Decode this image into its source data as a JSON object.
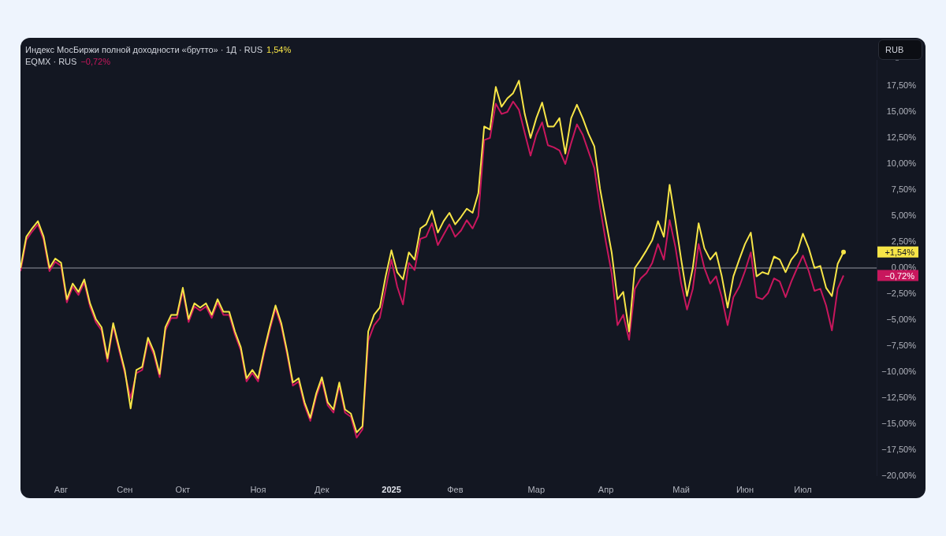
{
  "currency_button": "RUB",
  "legend": [
    {
      "value": "1,54%"
    },
    {
      "value": "−0,72%"
    }
  ],
  "price_tags": [
    {
      "label": "+1,54%"
    },
    {
      "label": "−0,72%"
    }
  ],
  "chart_data": {
    "type": "line",
    "ylim": [
      -20,
      20
    ],
    "categories": [
      null,
      null,
      null,
      null,
      null,
      null,
      null,
      "Авг",
      null,
      null,
      null,
      null,
      null,
      null,
      null,
      null,
      null,
      null,
      "Сен",
      null,
      null,
      null,
      null,
      null,
      null,
      null,
      null,
      null,
      "Окт",
      null,
      null,
      null,
      null,
      null,
      null,
      null,
      null,
      null,
      null,
      null,
      null,
      "Ноя",
      null,
      null,
      null,
      null,
      null,
      null,
      null,
      null,
      null,
      null,
      "Дек",
      null,
      null,
      null,
      null,
      null,
      null,
      null,
      null,
      null,
      null,
      null,
      "**2025**",
      null,
      null,
      null,
      null,
      null,
      null,
      null,
      null,
      null,
      null,
      "Фев",
      null,
      null,
      null,
      null,
      null,
      null,
      null,
      null,
      null,
      null,
      null,
      null,
      null,
      "Мар",
      null,
      null,
      null,
      null,
      null,
      null,
      null,
      null,
      null,
      null,
      null,
      "Апр",
      null,
      null,
      null,
      null,
      null,
      null,
      null,
      null,
      null,
      null,
      null,
      null,
      "Май",
      null,
      null,
      null,
      null,
      null,
      null,
      null,
      null,
      null,
      null,
      "Июн",
      null,
      null,
      null,
      null,
      null,
      null,
      null,
      null,
      null,
      "Июл",
      null,
      null,
      null,
      null,
      null,
      null,
      null
    ],
    "series": [
      {
        "name": "Индекс МосБиржи полной доходности «брутто» · 1Д · RUS",
        "color": "#f7e547",
        "values": [
          0,
          3.0,
          3.8,
          4.5,
          3.0,
          0,
          0.9,
          0.5,
          -3.0,
          -1.5,
          -2.3,
          -1.1,
          -3.4,
          -4.9,
          -5.7,
          -8.7,
          -5.3,
          -7.6,
          -9.8,
          -13.5,
          -9.8,
          -9.5,
          -6.7,
          -8.0,
          -10.2,
          -5.7,
          -4.5,
          -4.5,
          -1.9,
          -4.9,
          -3.4,
          -3.8,
          -3.4,
          -4.5,
          -3.0,
          -4.2,
          -4.2,
          -6.1,
          -7.6,
          -10.6,
          -9.8,
          -10.6,
          -8.0,
          -5.7,
          -3.6,
          -5.3,
          -8.0,
          -11.0,
          -10.6,
          -12.9,
          -14.4,
          -12.1,
          -10.5,
          -12.9,
          -13.6,
          -11.0,
          -13.6,
          -14.0,
          -15.8,
          -15.2,
          -6.1,
          -4.5,
          -3.8,
          -0.8,
          1.7,
          -0.4,
          -1.1,
          1.5,
          0.8,
          3.8,
          4.2,
          5.5,
          3.4,
          4.5,
          5.3,
          4.2,
          4.9,
          5.7,
          5.3,
          7.2,
          13.6,
          13.3,
          17.4,
          15.5,
          16.3,
          16.8,
          18.0,
          14.8,
          12.5,
          14.4,
          15.9,
          13.6,
          13.6,
          14.4,
          11.0,
          14.4,
          15.7,
          14.4,
          12.9,
          11.7,
          7.6,
          4.5,
          1.5,
          -3.0,
          -2.3,
          -6.1,
          0,
          0.8,
          1.7,
          2.7,
          4.5,
          3.0,
          8.0,
          4.5,
          0.8,
          -2.7,
          0,
          4.3,
          1.9,
          0.8,
          1.5,
          -0.8,
          -3.8,
          -0.8,
          0.8,
          2.3,
          3.4,
          -0.8,
          -0.4,
          -0.6,
          1.1,
          0.8,
          -0.4,
          0.8,
          1.5,
          3.3,
          1.9,
          0,
          0.2,
          -1.9,
          -2.7,
          0.4,
          1.54
        ]
      },
      {
        "name": "EQMX · RUS",
        "color": "#c8175d",
        "values": [
          -0.3,
          2.7,
          3.5,
          4.2,
          2.7,
          -0.3,
          0.6,
          0.2,
          -3.3,
          -1.8,
          -2.6,
          -1.4,
          -3.7,
          -5.2,
          -6.0,
          -9.0,
          -5.6,
          -7.9,
          -10.1,
          -12.5,
          -10.1,
          -9.8,
          -7.0,
          -8.3,
          -10.5,
          -6.0,
          -4.8,
          -4.8,
          -2.2,
          -5.2,
          -3.7,
          -4.1,
          -3.7,
          -4.8,
          -3.3,
          -4.5,
          -4.5,
          -6.4,
          -7.9,
          -10.9,
          -10.1,
          -10.9,
          -8.3,
          -6.0,
          -3.9,
          -5.6,
          -8.3,
          -11.3,
          -10.9,
          -13.2,
          -14.7,
          -12.4,
          -10.8,
          -13.2,
          -13.9,
          -11.3,
          -13.9,
          -14.3,
          -16.3,
          -15.5,
          -7.0,
          -5.5,
          -4.8,
          -2.0,
          0.8,
          -1.8,
          -3.5,
          0.5,
          -0.2,
          2.8,
          3.0,
          4.3,
          2.2,
          3.2,
          4.2,
          3.0,
          3.6,
          4.6,
          3.8,
          5.0,
          12.3,
          12.5,
          15.8,
          14.8,
          15.0,
          16.0,
          15.2,
          13.0,
          10.8,
          12.8,
          14.0,
          11.8,
          11.6,
          11.3,
          10.0,
          12.0,
          13.8,
          12.8,
          11.2,
          9.6,
          5.8,
          2.5,
          -0.5,
          -5.5,
          -4.5,
          -6.9,
          -2.0,
          -1.0,
          -0.5,
          0.5,
          2.3,
          0.8,
          4.6,
          2.0,
          -1.5,
          -4.0,
          -2.0,
          2.3,
          0.0,
          -1.5,
          -0.8,
          -2.8,
          -5.5,
          -2.8,
          -1.8,
          -0.3,
          1.5,
          -2.8,
          -3.0,
          -2.4,
          -1.0,
          -1.3,
          -2.8,
          -1.3,
          0,
          1.2,
          -0.3,
          -2.2,
          -2.0,
          -3.6,
          -6.0,
          -2.0,
          -0.72
        ]
      }
    ],
    "yticks": [
      {
        "value": 17.5,
        "label": "17,50%"
      },
      {
        "value": 15,
        "label": "15,00%"
      },
      {
        "value": 12.5,
        "label": "12,50%"
      },
      {
        "value": 10,
        "label": "10,00%"
      },
      {
        "value": 7.5,
        "label": "7,50%"
      },
      {
        "value": 5,
        "label": "5,00%"
      },
      {
        "value": 2.5,
        "label": "2,50%"
      },
      {
        "value": 0,
        "label": "0,00%"
      },
      {
        "value": -2.5,
        "label": "−2,50%"
      },
      {
        "value": -5,
        "label": "−5,00%"
      },
      {
        "value": -7.5,
        "label": "−7,50%"
      },
      {
        "value": -10,
        "label": "−10,00%"
      },
      {
        "value": -12.5,
        "label": "−12,50%"
      },
      {
        "value": -15,
        "label": "−15,00%"
      },
      {
        "value": -17.5,
        "label": "−17,50%"
      },
      {
        "value": -20,
        "label": "−20,00%"
      }
    ]
  }
}
